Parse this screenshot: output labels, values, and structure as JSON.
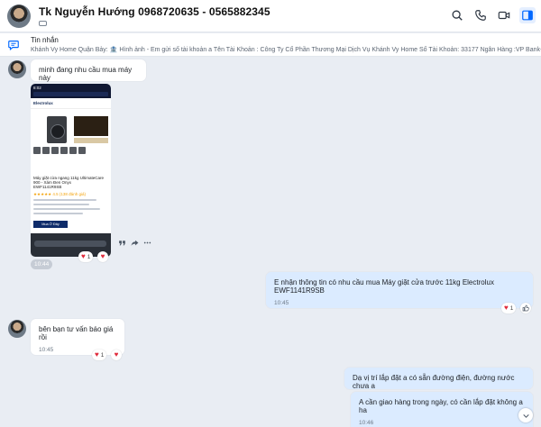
{
  "header": {
    "title": "Tk Nguyễn Hướng 0968720635 - 0565882345",
    "actions": [
      "search-icon",
      "phone-icon",
      "video-icon",
      "sidebar-toggle-icon"
    ]
  },
  "pinned": {
    "label": "Tin nhắn",
    "text": "Khánh Vy Home Quận Bảy: 🏦 Hình ảnh - Em gửi số tài khoản a Tên Tài Khoản : Công Ty Cổ Phần Thương Mại Dịch Vụ Khánh Vy Home Số Tài Khoản: 33177 Ngân Hàng :VP Bank-CN Nộ Trang L..."
  },
  "messages": {
    "m1": {
      "text": "minh đang nhu cầu mua máy này"
    },
    "image": {
      "time": "10:44",
      "brand": "Electrolux",
      "status_time": "8:02",
      "product_name": "Máy giặt cửa ngang 11kg UltimateCare 900 - Xám Đen Onyx",
      "product_code": "EWF1141R9SB",
      "rating": "★★★★★ 4.5 (138 đánh giá)",
      "buy_label": "Mua Ở Đây",
      "reaction_count": "1"
    },
    "m2": {
      "text": "E nhận thông tin có nhu cầu mua Máy giặt cửa trước 11kg Electrolux EWF1141R9SB",
      "time": "10:45",
      "reaction_count": "1"
    },
    "m3": {
      "text": "bên bạn tư vấn báo giá rồi",
      "time": "10:45",
      "reaction_count": "1"
    },
    "m4": {
      "text": "Dạ vị trí lắp đặt a có sẵn đường điện, đường nước chưa a"
    },
    "m5": {
      "text": "A cần giao hàng trong ngày, có cần lắp đặt không a ha",
      "time": "10:46"
    }
  },
  "colors": {
    "background": "#e9edf3",
    "outgoing_bubble": "#dbebff",
    "incoming_bubble": "#ffffff",
    "heart": "#e02a3b",
    "accent": "#0068ff"
  }
}
